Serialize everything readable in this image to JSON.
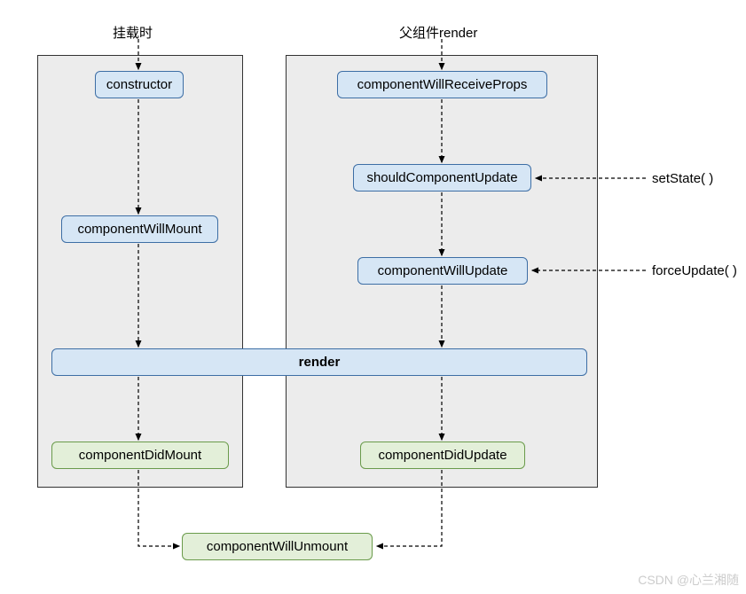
{
  "titles": {
    "mounting": "挂载时",
    "parentRender": "父组件render"
  },
  "mount": {
    "constructor": "constructor",
    "willMount": "componentWillMount",
    "didMount": "componentDidMount"
  },
  "update": {
    "willReceiveProps": "componentWillReceiveProps",
    "shouldUpdate": "shouldComponentUpdate",
    "willUpdate": "componentWillUpdate",
    "didUpdate": "componentDidUpdate"
  },
  "shared": {
    "render": "render",
    "willUnmount": "componentWillUnmount"
  },
  "external": {
    "setState": "setState( )",
    "forceUpdate": "forceUpdate( )"
  },
  "watermark": "CSDN @心兰湘随",
  "chart_data": {
    "type": "flow-diagram",
    "title": "React Component Lifecycle (legacy)",
    "columns": [
      {
        "name": "mounting",
        "label": "挂载时",
        "sequence": [
          "constructor",
          "componentWillMount",
          "render",
          "componentDidMount",
          "componentWillUnmount"
        ]
      },
      {
        "name": "updating",
        "label": "父组件render",
        "sequence": [
          "componentWillReceiveProps",
          "shouldComponentUpdate",
          "componentWillUpdate",
          "render",
          "componentDidUpdate",
          "componentWillUnmount"
        ]
      }
    ],
    "external_triggers": [
      {
        "label": "setState( )",
        "target": "shouldComponentUpdate"
      },
      {
        "label": "forceUpdate( )",
        "target": "componentWillUpdate"
      }
    ],
    "commit_phase_nodes": [
      "componentDidMount",
      "componentDidUpdate",
      "componentWillUnmount"
    ],
    "render_phase_nodes": [
      "constructor",
      "componentWillMount",
      "componentWillReceiveProps",
      "shouldComponentUpdate",
      "componentWillUpdate",
      "render"
    ]
  }
}
